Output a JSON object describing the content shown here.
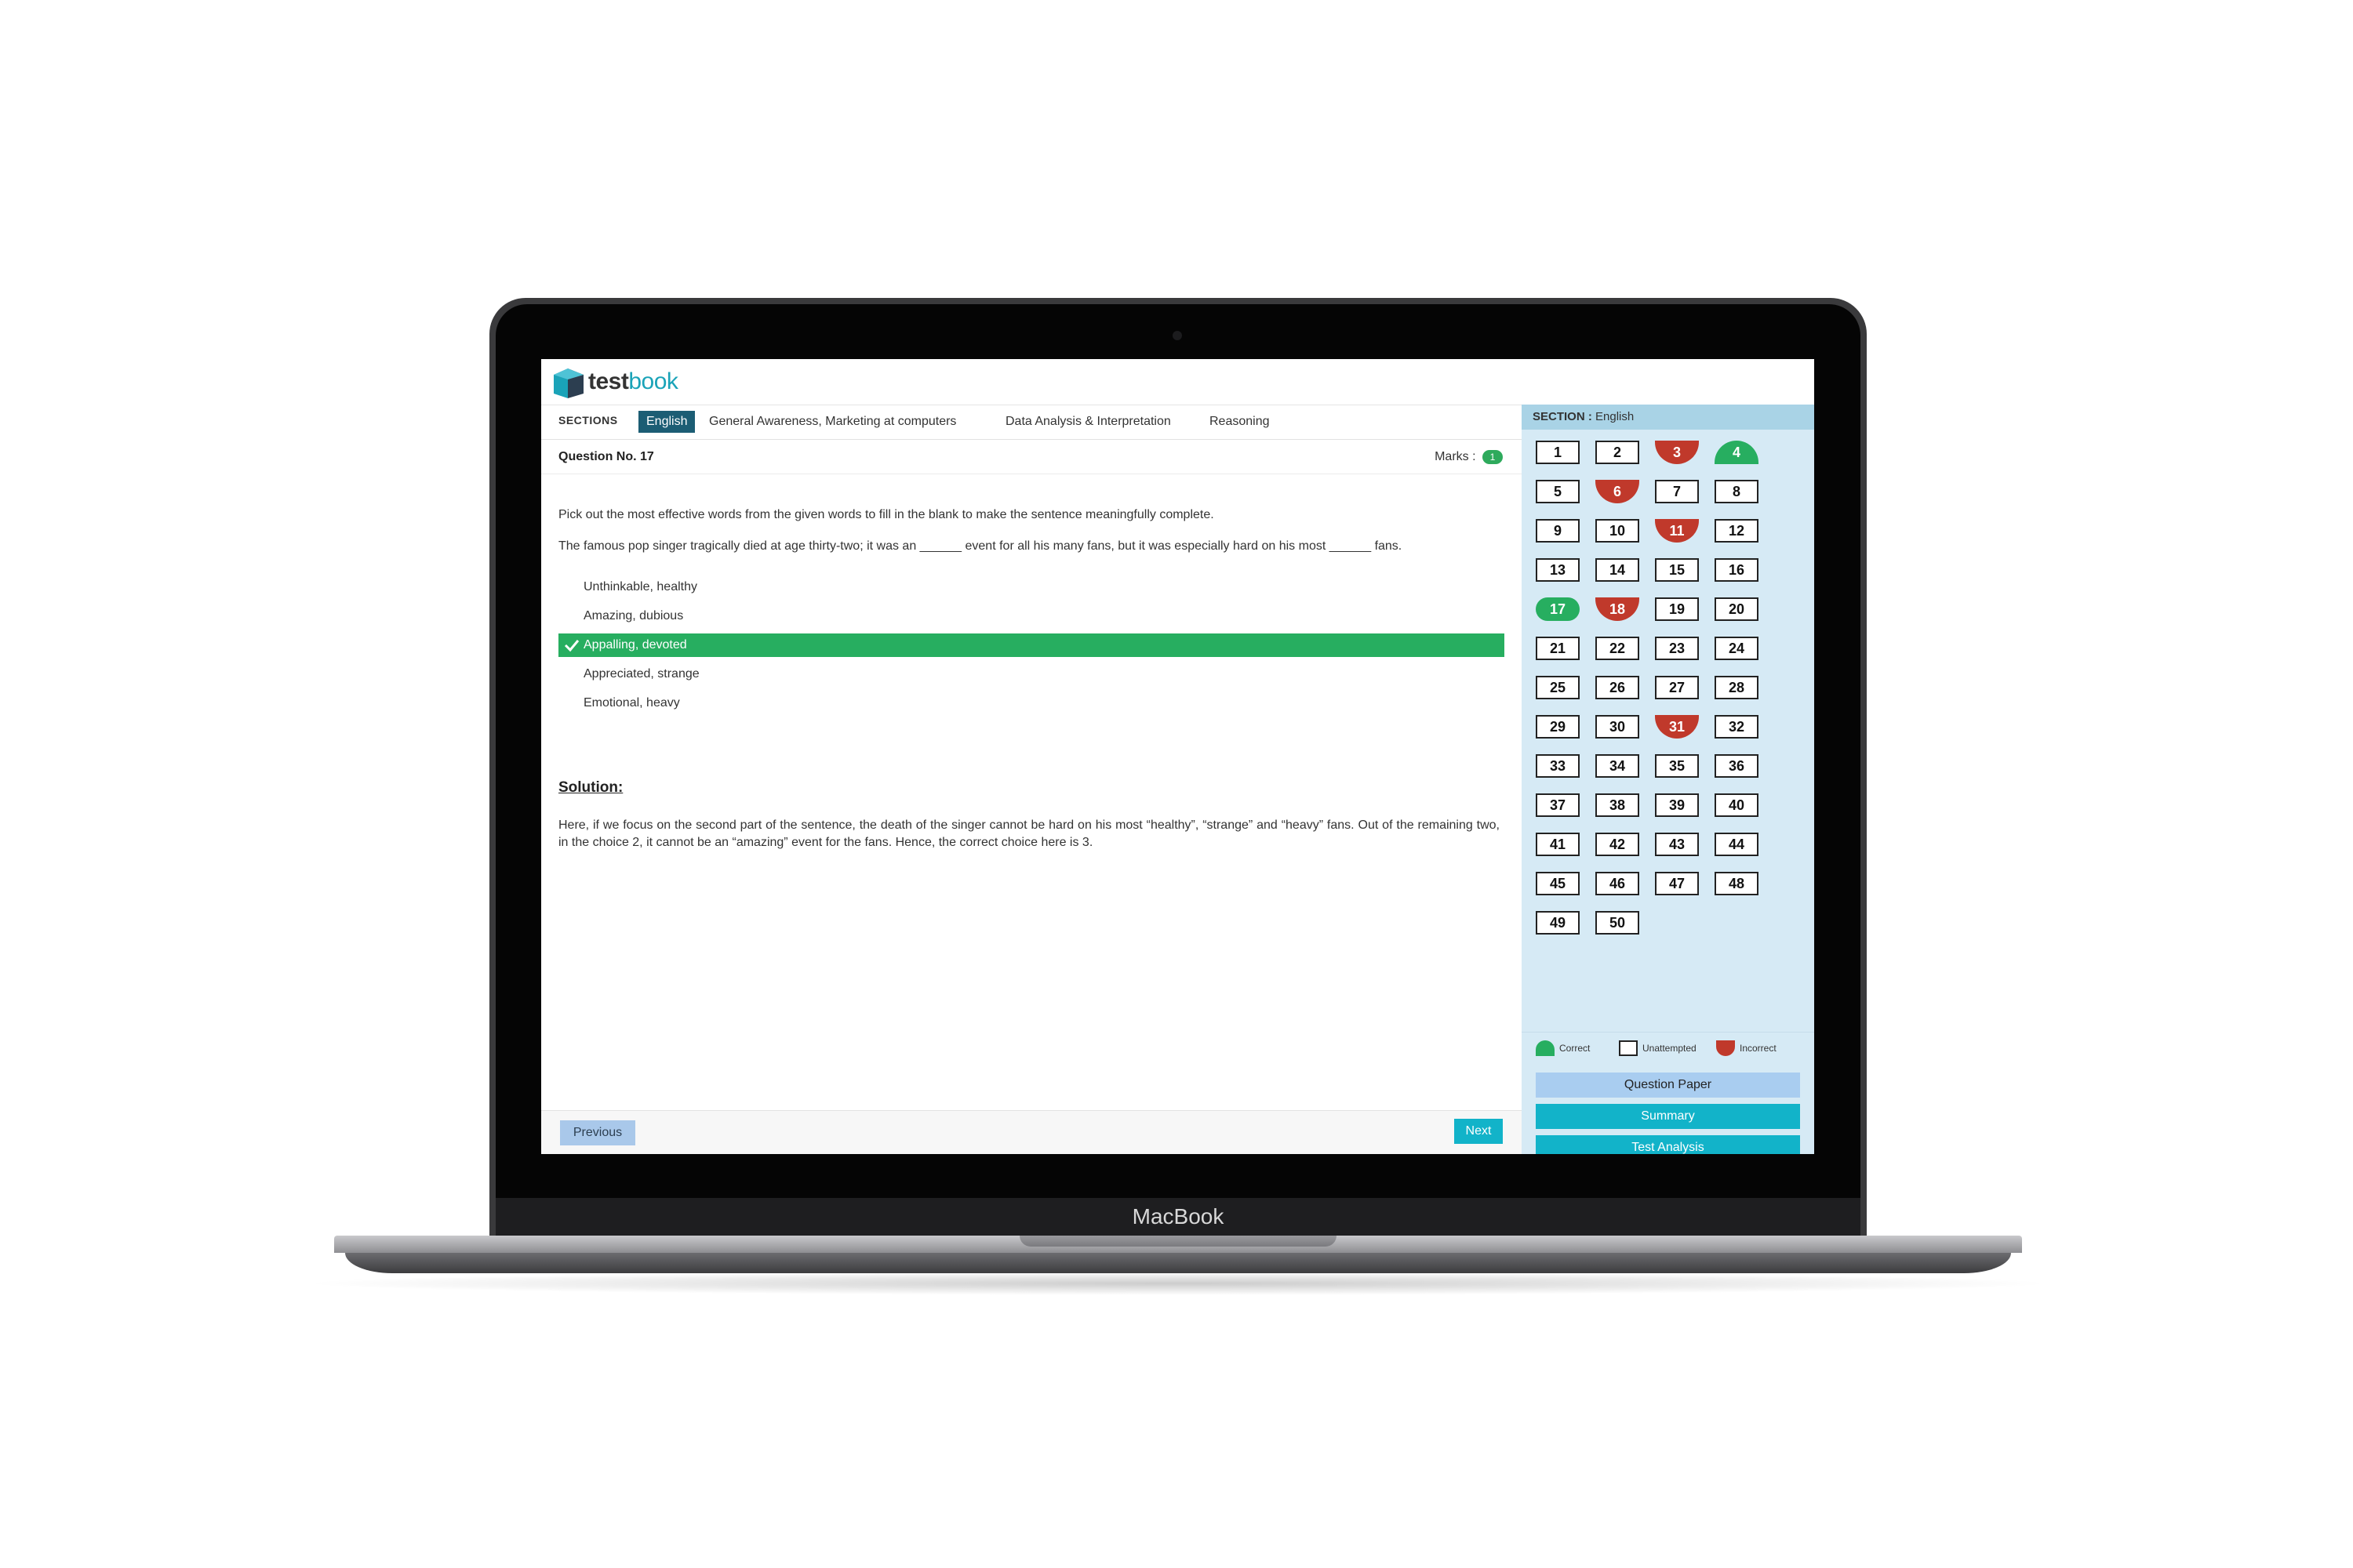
{
  "device": {
    "brand": "MacBook"
  },
  "app": {
    "logo_bold": "test",
    "logo_light": "book"
  },
  "sections": {
    "label": "SECTIONS",
    "tabs": [
      {
        "label": "English",
        "active": true
      },
      {
        "label": "General Awareness, Marketing at computers",
        "active": false
      },
      {
        "label": "Data Analysis & Interpretation",
        "active": false
      },
      {
        "label": "Reasoning",
        "active": false
      }
    ]
  },
  "question": {
    "number_label": "Question No. 17",
    "marks_label": "Marks :",
    "marks_value": "1",
    "instruction": "Pick out the most effective words from the given words to fill in the blank to make the sentence meaningfully complete.",
    "text": "The famous pop singer tragically died at age thirty-two; it was an ______ event for all his many fans, but it was especially hard on his most ______ fans.",
    "options": [
      {
        "label": "Unthinkable, healthy",
        "selected": false
      },
      {
        "label": "Amazing, dubious",
        "selected": false
      },
      {
        "label": "Appalling, devoted",
        "selected": true
      },
      {
        "label": "Appreciated, strange",
        "selected": false
      },
      {
        "label": "Emotional, heavy",
        "selected": false
      }
    ]
  },
  "solution": {
    "title": "Solution:",
    "text": "Here, if we focus on the second part of the sentence, the death of the singer cannot be hard on his most “healthy”, “strange” and “heavy” fans. Out of the remaining two, in the choice 2, it cannot be an “amazing” event for the fans. Hence, the correct choice here is 3."
  },
  "nav": {
    "previous_label": "Previous",
    "next_label": "Next"
  },
  "palette": {
    "section_label": "SECTION :",
    "section_value": "English",
    "total": 50,
    "correct": [
      4,
      17
    ],
    "incorrect": [
      3,
      6,
      11,
      18,
      31
    ],
    "current": 17
  },
  "legend": {
    "correct_label": "Correct",
    "unattempted_label": "Unattempted",
    "incorrect_label": "Incorrect"
  },
  "actions": {
    "question_paper_label": "Question Paper",
    "summary_label": "Summary",
    "test_analysis_label": "Test Analysis"
  },
  "colors": {
    "correct": "#27ae60",
    "incorrect": "#c0392b",
    "accent": "#12b3c9",
    "section_active": "#1c5d74"
  }
}
